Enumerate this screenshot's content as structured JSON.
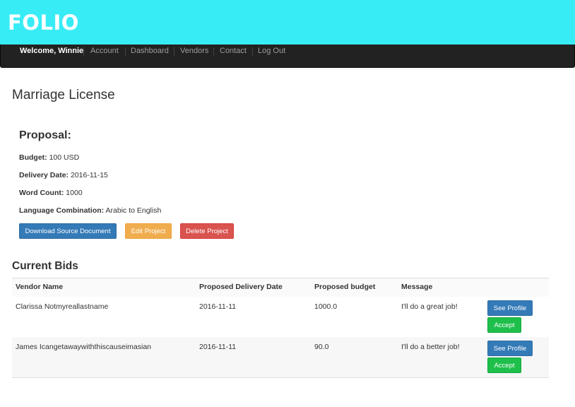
{
  "brand": {
    "logo": "FOLIO"
  },
  "nav": {
    "welcome": "Welcome, Winnie",
    "links": [
      "Account",
      "Dashboard",
      "Vendors",
      "Contact",
      "Log Out"
    ]
  },
  "page": {
    "title": "Marriage License"
  },
  "proposal": {
    "heading": "Proposal:",
    "budget_label": "Budget:",
    "budget": "100 USD",
    "delivery_label": "Delivery Date:",
    "delivery": "2016-11-15",
    "wordcount_label": "Word Count:",
    "wordcount": "1000",
    "language_label": "Language Combination:",
    "language": "Arabic to English",
    "buttons": {
      "download": "Download Source Document",
      "edit": "Edit Project",
      "delete": "Delete Project"
    }
  },
  "bids": {
    "heading": "Current Bids",
    "columns": [
      "Vendor Name",
      "Proposed Delivery Date",
      "Proposed budget",
      "Message"
    ],
    "rows": [
      {
        "vendor": "Clarissa Notmyreallastname",
        "date": "2016-11-11",
        "budget": "1000.0",
        "message": "I'll do a great job!",
        "profile_label": "See Profile",
        "accept_label": "Accept"
      },
      {
        "vendor": "James Icangetawaywiththiscauseimasian",
        "date": "2016-11-11",
        "budget": "90.0",
        "message": "I'll do a better job!",
        "profile_label": "See Profile",
        "accept_label": "Accept"
      }
    ]
  },
  "colors": {
    "brand_bar": "#38ecf6",
    "navbar": "#222222",
    "primary": "#337ab7",
    "warning": "#f0ad4e",
    "danger": "#d9534f",
    "success": "#1fbf4b"
  }
}
